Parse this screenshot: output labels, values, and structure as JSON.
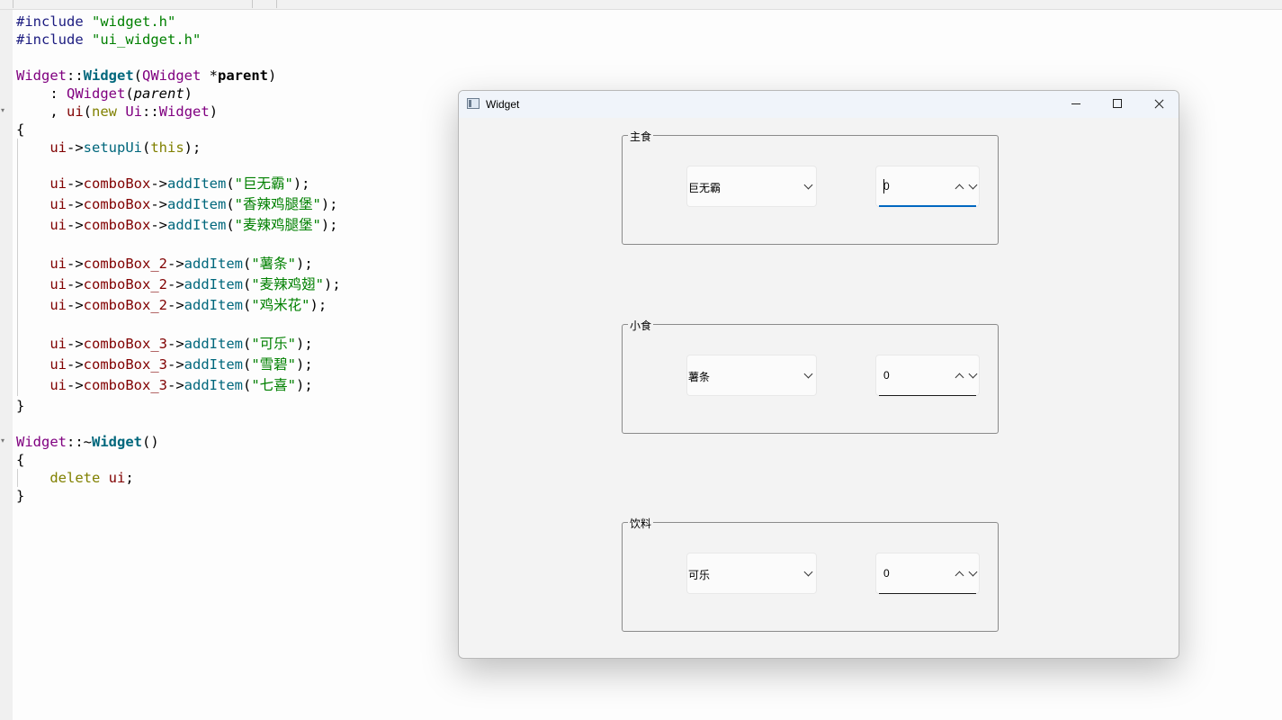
{
  "editor": {
    "lines": [
      [
        {
          "t": "#include ",
          "c": "pp"
        },
        {
          "t": "\"widget.h\"",
          "c": "st"
        }
      ],
      [
        {
          "t": "#include ",
          "c": "pp"
        },
        {
          "t": "\"ui_widget.h\"",
          "c": "st"
        }
      ],
      [],
      [
        {
          "t": "Widget",
          "c": "cls"
        },
        {
          "t": "::",
          "c": ""
        },
        {
          "t": "Widget",
          "c": "fnb"
        },
        {
          "t": "(",
          "c": ""
        },
        {
          "t": "QWidget",
          "c": "cls"
        },
        {
          "t": " *",
          "c": ""
        },
        {
          "t": "parent",
          "c": "parb"
        },
        {
          "t": ")",
          "c": ""
        }
      ],
      [
        {
          "t": "    : ",
          "c": ""
        },
        {
          "t": "QWidget",
          "c": "cls"
        },
        {
          "t": "(",
          "c": ""
        },
        {
          "t": "parent",
          "c": "par"
        },
        {
          "t": ")",
          "c": ""
        }
      ],
      [
        {
          "t": "    , ",
          "c": ""
        },
        {
          "t": "ui",
          "c": "mem"
        },
        {
          "t": "(",
          "c": ""
        },
        {
          "t": "new",
          "c": "kw"
        },
        {
          "t": " ",
          "c": ""
        },
        {
          "t": "Ui",
          "c": "cls"
        },
        {
          "t": "::",
          "c": ""
        },
        {
          "t": "Widget",
          "c": "cls"
        },
        {
          "t": ")",
          "c": ""
        }
      ],
      [
        {
          "t": "{",
          "c": ""
        }
      ],
      [
        {
          "t": "    ",
          "c": ""
        },
        {
          "t": "ui",
          "c": "mem"
        },
        {
          "t": "->",
          "c": ""
        },
        {
          "t": "setupUi",
          "c": "fn"
        },
        {
          "t": "(",
          "c": ""
        },
        {
          "t": "this",
          "c": "kw"
        },
        {
          "t": ");",
          "c": ""
        }
      ],
      [],
      [
        {
          "t": "    ",
          "c": ""
        },
        {
          "t": "ui",
          "c": "mem"
        },
        {
          "t": "->",
          "c": ""
        },
        {
          "t": "comboBox",
          "c": "mem"
        },
        {
          "t": "->",
          "c": ""
        },
        {
          "t": "addItem",
          "c": "fn"
        },
        {
          "t": "(",
          "c": ""
        },
        {
          "t": "\"巨无霸\"",
          "c": "st"
        },
        {
          "t": ");",
          "c": ""
        }
      ],
      [
        {
          "t": "    ",
          "c": ""
        },
        {
          "t": "ui",
          "c": "mem"
        },
        {
          "t": "->",
          "c": ""
        },
        {
          "t": "comboBox",
          "c": "mem"
        },
        {
          "t": "->",
          "c": ""
        },
        {
          "t": "addItem",
          "c": "fn"
        },
        {
          "t": "(",
          "c": ""
        },
        {
          "t": "\"香辣鸡腿堡\"",
          "c": "st"
        },
        {
          "t": ");",
          "c": ""
        }
      ],
      [
        {
          "t": "    ",
          "c": ""
        },
        {
          "t": "ui",
          "c": "mem"
        },
        {
          "t": "->",
          "c": ""
        },
        {
          "t": "comboBox",
          "c": "mem"
        },
        {
          "t": "->",
          "c": ""
        },
        {
          "t": "addItem",
          "c": "fn"
        },
        {
          "t": "(",
          "c": ""
        },
        {
          "t": "\"麦辣鸡腿堡\"",
          "c": "st"
        },
        {
          "t": ");",
          "c": ""
        }
      ],
      [],
      [
        {
          "t": "    ",
          "c": ""
        },
        {
          "t": "ui",
          "c": "mem"
        },
        {
          "t": "->",
          "c": ""
        },
        {
          "t": "comboBox_2",
          "c": "mem"
        },
        {
          "t": "->",
          "c": ""
        },
        {
          "t": "addItem",
          "c": "fn"
        },
        {
          "t": "(",
          "c": ""
        },
        {
          "t": "\"薯条\"",
          "c": "st"
        },
        {
          "t": ");",
          "c": ""
        }
      ],
      [
        {
          "t": "    ",
          "c": ""
        },
        {
          "t": "ui",
          "c": "mem"
        },
        {
          "t": "->",
          "c": ""
        },
        {
          "t": "comboBox_2",
          "c": "mem"
        },
        {
          "t": "->",
          "c": ""
        },
        {
          "t": "addItem",
          "c": "fn"
        },
        {
          "t": "(",
          "c": ""
        },
        {
          "t": "\"麦辣鸡翅\"",
          "c": "st"
        },
        {
          "t": ");",
          "c": ""
        }
      ],
      [
        {
          "t": "    ",
          "c": ""
        },
        {
          "t": "ui",
          "c": "mem"
        },
        {
          "t": "->",
          "c": ""
        },
        {
          "t": "comboBox_2",
          "c": "mem"
        },
        {
          "t": "->",
          "c": ""
        },
        {
          "t": "addItem",
          "c": "fn"
        },
        {
          "t": "(",
          "c": ""
        },
        {
          "t": "\"鸡米花\"",
          "c": "st"
        },
        {
          "t": ");",
          "c": ""
        }
      ],
      [],
      [
        {
          "t": "    ",
          "c": ""
        },
        {
          "t": "ui",
          "c": "mem"
        },
        {
          "t": "->",
          "c": ""
        },
        {
          "t": "comboBox_3",
          "c": "mem"
        },
        {
          "t": "->",
          "c": ""
        },
        {
          "t": "addItem",
          "c": "fn"
        },
        {
          "t": "(",
          "c": ""
        },
        {
          "t": "\"可乐\"",
          "c": "st"
        },
        {
          "t": ");",
          "c": ""
        }
      ],
      [
        {
          "t": "    ",
          "c": ""
        },
        {
          "t": "ui",
          "c": "mem"
        },
        {
          "t": "->",
          "c": ""
        },
        {
          "t": "comboBox_3",
          "c": "mem"
        },
        {
          "t": "->",
          "c": ""
        },
        {
          "t": "addItem",
          "c": "fn"
        },
        {
          "t": "(",
          "c": ""
        },
        {
          "t": "\"雪碧\"",
          "c": "st"
        },
        {
          "t": ");",
          "c": ""
        }
      ],
      [
        {
          "t": "    ",
          "c": ""
        },
        {
          "t": "ui",
          "c": "mem"
        },
        {
          "t": "->",
          "c": ""
        },
        {
          "t": "comboBox_3",
          "c": "mem"
        },
        {
          "t": "->",
          "c": ""
        },
        {
          "t": "addItem",
          "c": "fn"
        },
        {
          "t": "(",
          "c": ""
        },
        {
          "t": "\"七喜\"",
          "c": "st"
        },
        {
          "t": ");",
          "c": ""
        }
      ],
      [
        {
          "t": "}",
          "c": ""
        }
      ],
      [],
      [
        {
          "t": "Widget",
          "c": "cls"
        },
        {
          "t": "::~",
          "c": ""
        },
        {
          "t": "Widget",
          "c": "fnb"
        },
        {
          "t": "()",
          "c": ""
        }
      ],
      [
        {
          "t": "{",
          "c": ""
        }
      ],
      [
        {
          "t": "    ",
          "c": ""
        },
        {
          "t": "delete",
          "c": "kw"
        },
        {
          "t": " ",
          "c": ""
        },
        {
          "t": "ui",
          "c": "mem"
        },
        {
          "t": ";",
          "c": ""
        }
      ],
      [
        {
          "t": "}",
          "c": ""
        }
      ]
    ]
  },
  "window": {
    "title": "Widget",
    "groups": [
      {
        "title": "主食",
        "combo_value": "巨无霸",
        "spin_value": "0"
      },
      {
        "title": "小食",
        "combo_value": "薯条",
        "spin_value": "0"
      },
      {
        "title": "饮料",
        "combo_value": "可乐",
        "spin_value": "0"
      }
    ]
  }
}
